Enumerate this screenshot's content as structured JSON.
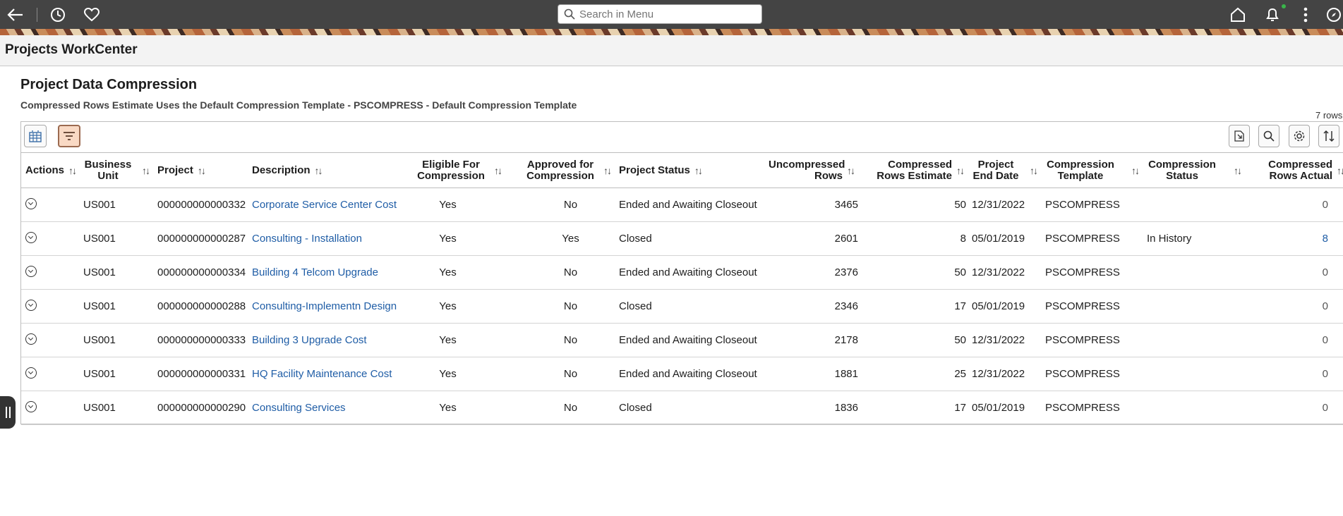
{
  "topbar": {
    "search_placeholder": "Search in Menu",
    "icons": [
      "back-arrow-icon",
      "history-icon",
      "favorites-heart-icon",
      "search-icon",
      "home-icon",
      "notifications-bell-icon",
      "actions-menu-icon",
      "navbar-compass-icon"
    ]
  },
  "workcenter": {
    "title": "Projects WorkCenter"
  },
  "page": {
    "title": "Project Data Compression",
    "subtitle": "Compressed Rows Estimate Uses the Default Compression Template - PSCOMPRESS - Default Compression Template",
    "row_count": "7 rows"
  },
  "toolbar": {
    "left": [
      "grid-view-icon",
      "filter-icon"
    ],
    "right": [
      "download-icon",
      "find-icon",
      "settings-gear-icon",
      "sort-icon"
    ]
  },
  "table": {
    "headers": [
      "Actions",
      "Business Unit",
      "Project",
      "Description",
      "Eligible For Compression",
      "Approved for Compression",
      "Project Status",
      "Uncompressed Rows",
      "Compressed Rows Estimate",
      "Project End Date",
      "Compression Template",
      "Compression Status",
      "Compressed Rows Actual"
    ],
    "rows": [
      {
        "bu": "US001",
        "project": "000000000000332",
        "description": "Corporate Service Center Cost",
        "eligible": "Yes",
        "approved": "No",
        "status": "Ended and Awaiting Closeout",
        "uncompressed": "3465",
        "estimate": "50",
        "end_date": "12/31/2022",
        "template": "PSCOMPRESS",
        "comp_status": "",
        "actual": "0"
      },
      {
        "bu": "US001",
        "project": "000000000000287",
        "description": "Consulting - Installation",
        "eligible": "Yes",
        "approved": "Yes",
        "status": "Closed",
        "uncompressed": "2601",
        "estimate": "8",
        "end_date": "05/01/2019",
        "template": "PSCOMPRESS",
        "comp_status": "In History",
        "actual": "8"
      },
      {
        "bu": "US001",
        "project": "000000000000334",
        "description": "Building 4 Telcom Upgrade",
        "eligible": "Yes",
        "approved": "No",
        "status": "Ended and Awaiting Closeout",
        "uncompressed": "2376",
        "estimate": "50",
        "end_date": "12/31/2022",
        "template": "PSCOMPRESS",
        "comp_status": "",
        "actual": "0"
      },
      {
        "bu": "US001",
        "project": "000000000000288",
        "description": "Consulting-Implementn Design",
        "eligible": "Yes",
        "approved": "No",
        "status": "Closed",
        "uncompressed": "2346",
        "estimate": "17",
        "end_date": "05/01/2019",
        "template": "PSCOMPRESS",
        "comp_status": "",
        "actual": "0"
      },
      {
        "bu": "US001",
        "project": "000000000000333",
        "description": "Building 3 Upgrade Cost",
        "eligible": "Yes",
        "approved": "No",
        "status": "Ended and Awaiting Closeout",
        "uncompressed": "2178",
        "estimate": "50",
        "end_date": "12/31/2022",
        "template": "PSCOMPRESS",
        "comp_status": "",
        "actual": "0"
      },
      {
        "bu": "US001",
        "project": "000000000000331",
        "description": "HQ Facility Maintenance Cost",
        "eligible": "Yes",
        "approved": "No",
        "status": "Ended and Awaiting Closeout",
        "uncompressed": "1881",
        "estimate": "25",
        "end_date": "12/31/2022",
        "template": "PSCOMPRESS",
        "comp_status": "",
        "actual": "0"
      },
      {
        "bu": "US001",
        "project": "000000000000290",
        "description": "Consulting Services",
        "eligible": "Yes",
        "approved": "No",
        "status": "Closed",
        "uncompressed": "1836",
        "estimate": "17",
        "end_date": "05/01/2019",
        "template": "PSCOMPRESS",
        "comp_status": "",
        "actual": "0"
      }
    ]
  }
}
